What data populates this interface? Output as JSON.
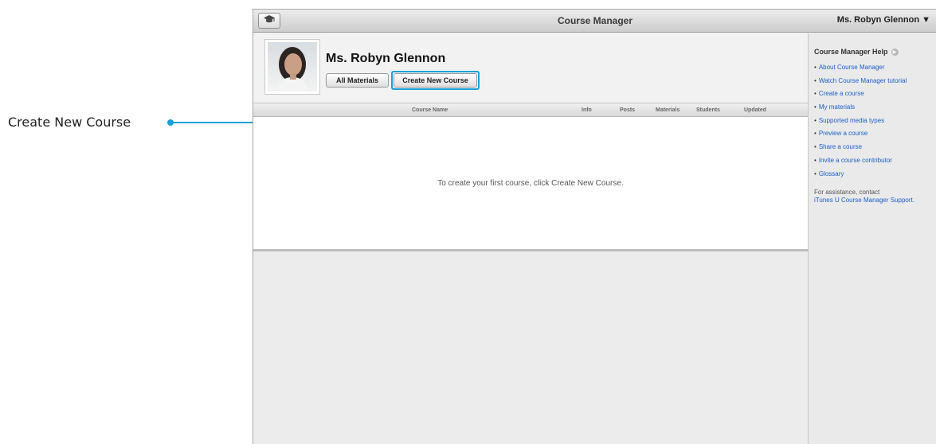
{
  "callout": {
    "label": "Create New Course"
  },
  "window": {
    "title": "Course Manager",
    "user_menu": "Ms. Robyn Glennon ▼"
  },
  "profile": {
    "name": "Ms. Robyn Glennon",
    "all_materials_label": "All Materials",
    "create_course_label": "Create New Course"
  },
  "table": {
    "headers": [
      "Course Name",
      "Info",
      "Posts",
      "Materials",
      "Students",
      "Updated"
    ],
    "empty_message": "To create your first course, click Create New Course."
  },
  "help": {
    "title": "Course Manager Help",
    "items": [
      "About Course Manager",
      "Watch Course Manager tutorial",
      "Create a course",
      "My materials",
      "Supported media types",
      "Preview a course",
      "Share a course",
      "Invite a course contributor",
      "Glossary"
    ],
    "assist_text": "For assistance, contact",
    "assist_link": "iTunes U Course Manager Support."
  },
  "colors": {
    "accent": "#1aa0d8",
    "link": "#1c5fc7"
  }
}
